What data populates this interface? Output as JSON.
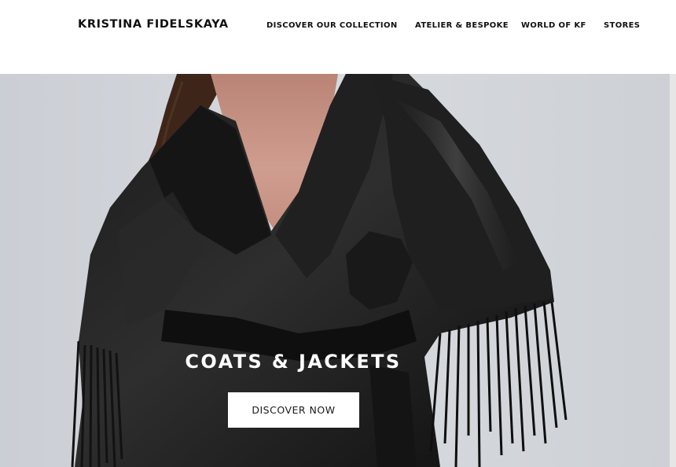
{
  "header": {
    "brand": "KRISTINA FIDELSKAYA",
    "nav": [
      {
        "label": "DISCOVER OUR COLLECTION"
      },
      {
        "label": "ATELIER & BESPOKE"
      },
      {
        "label": "WORLD OF KF"
      },
      {
        "label": "STORES"
      }
    ]
  },
  "hero": {
    "title": "COATS & JACKETS",
    "cta_label": "DISCOVER NOW",
    "image_subject": "model wearing black leather fringed wrap coat",
    "colors": {
      "background": "#d4d7dc",
      "garment": "#111111",
      "skin": "#c9968a",
      "hair": "#3a2418",
      "button_bg": "#ffffff",
      "button_text": "#1a1a1a",
      "title_text": "#ffffff"
    }
  }
}
